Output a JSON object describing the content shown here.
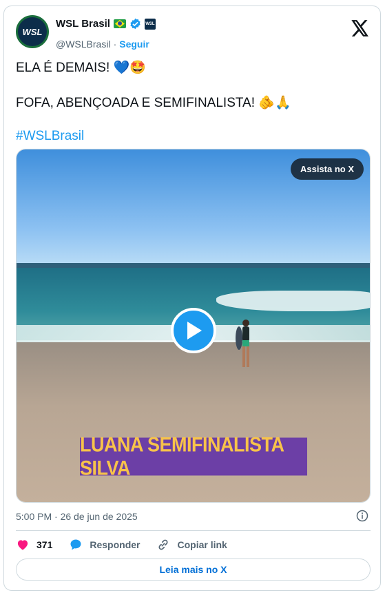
{
  "author": {
    "display_name": "WSL Brasil",
    "handle": "@WSLBrasil",
    "separator": "·",
    "follow_label": "Seguir",
    "avatar_text": "WSL",
    "affiliate_badge_text": "WSL"
  },
  "tweet": {
    "line1": "ELA É DEMAIS! 💙🤩",
    "line2": "FOFA, ABENÇOADA E SEMIFINALISTA! 🫵🙏",
    "hashtag": "#WSLBrasil"
  },
  "media": {
    "watch_button": "Assista no X",
    "caption": "LUANA SEMIFINALISTA SILVA"
  },
  "timestamp": "5:00 PM · 26 de jun de 2025",
  "actions": {
    "likes": "371",
    "reply_label": "Responder",
    "copy_link_label": "Copiar link"
  },
  "read_more_label": "Leia mais no X",
  "colors": {
    "accent": "#1d9bf0",
    "like": "#f91880",
    "caption_bg": "#6c3fa6",
    "caption_text": "#f7c34a"
  }
}
